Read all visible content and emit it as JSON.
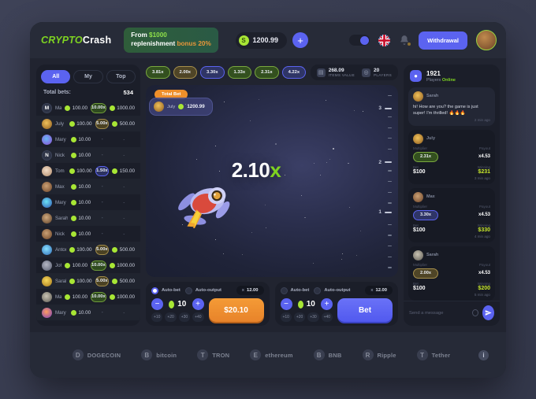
{
  "header": {
    "logo_part1": "CRYPTO",
    "logo_part2": "Crash",
    "promo_line1_pre": "From ",
    "promo_amount": "$1000",
    "promo_line2_pre": "replenishment ",
    "promo_bonus": "bonus 20%",
    "balance": "1200.99",
    "coin_symbol": "S",
    "add_funds_label": "+",
    "withdraw_label": "Withdrawal",
    "icons": {
      "theme": "moon-icon",
      "language": "uk-flag-icon",
      "notifications": "bell-icon",
      "profile": "avatar"
    }
  },
  "bets_panel": {
    "tabs": [
      {
        "label": "All",
        "active": true
      },
      {
        "label": "My",
        "active": false
      },
      {
        "label": "Top",
        "active": false
      }
    ],
    "total_label": "Total bets:",
    "total_value": "534",
    "rows": [
      {
        "name": "Mark",
        "avatar": "letter",
        "initial": "M",
        "bet": "100.00",
        "mult": "10.00x",
        "mult_style": "m-green",
        "win": "1000.00"
      },
      {
        "name": "July",
        "avatar": "p1",
        "initial": "",
        "bet": "100.00",
        "mult": "5.00x",
        "mult_style": "m-gold",
        "win": "500.00"
      },
      {
        "name": "Mary",
        "avatar": "p2",
        "initial": "",
        "bet": "10.00",
        "mult": "-",
        "mult_style": "m-none",
        "win": "-"
      },
      {
        "name": "Nick",
        "avatar": "letter",
        "initial": "N",
        "bet": "10.00",
        "mult": "-",
        "mult_style": "m-none",
        "win": "-"
      },
      {
        "name": "Tom",
        "avatar": "p3",
        "initial": "",
        "bet": "100.00",
        "mult": "1.50x",
        "mult_style": "m-blue",
        "win": "150.00"
      },
      {
        "name": "Max",
        "avatar": "p4",
        "initial": "",
        "bet": "10.00",
        "mult": "-",
        "mult_style": "m-none",
        "win": "-"
      },
      {
        "name": "Mary",
        "avatar": "p5",
        "initial": "",
        "bet": "10.00",
        "mult": "-",
        "mult_style": "m-none",
        "win": "-"
      },
      {
        "name": "Sarah",
        "avatar": "p6",
        "initial": "",
        "bet": "10.00",
        "mult": "-",
        "mult_style": "m-none",
        "win": "-"
      },
      {
        "name": "Nick",
        "avatar": "p4",
        "initial": "",
        "bet": "10.00",
        "mult": "-",
        "mult_style": "m-none",
        "win": "-"
      },
      {
        "name": "Antony",
        "avatar": "p7",
        "initial": "",
        "bet": "100.00",
        "mult": "5.00x",
        "mult_style": "m-gold",
        "win": "500.00"
      },
      {
        "name": "John",
        "avatar": "p8",
        "initial": "",
        "bet": "100.00",
        "mult": "10.00x",
        "mult_style": "m-green",
        "win": "1000.00"
      },
      {
        "name": "Sarah",
        "avatar": "p9",
        "initial": "",
        "bet": "100.00",
        "mult": "5.00x",
        "mult_style": "m-gold",
        "win": "500.00"
      },
      {
        "name": "Max",
        "avatar": "p10",
        "initial": "",
        "bet": "100.00",
        "mult": "10.00x",
        "mult_style": "m-green",
        "win": "1000.00"
      },
      {
        "name": "Mary",
        "avatar": "p11",
        "initial": "",
        "bet": "10.00",
        "mult": "-",
        "mult_style": "m-none",
        "win": "-"
      }
    ]
  },
  "game": {
    "history": [
      {
        "value": "3.81x",
        "style": "m-green"
      },
      {
        "value": "2.00x",
        "style": "m-gold"
      },
      {
        "value": "3.30x",
        "style": "m-blue"
      },
      {
        "value": "1.33x",
        "style": "m-green"
      },
      {
        "value": "2.31x",
        "style": "m-green"
      },
      {
        "value": "4.22x",
        "style": "m-blue"
      }
    ],
    "stats": [
      {
        "icon": "items-icon",
        "value": "268.09",
        "label": "ITEMS VALUE"
      },
      {
        "icon": "players-icon",
        "value": "20",
        "label": "PLAYERS"
      }
    ],
    "total_bet_chip": "Total Bet",
    "player_bet": {
      "name": "July",
      "value": "1200.99"
    },
    "multiplier": "2.10",
    "multiplier_suffix": "x",
    "axis_ticks": [
      "3",
      "2",
      "1"
    ],
    "rocket_icon": "rocket-astronaut-icon"
  },
  "controls": {
    "left": {
      "auto_bet_label": "Auto-bet",
      "auto_bet_on": true,
      "auto_output_label": "Auto-output",
      "auto_output_on": false,
      "auto_output_value": "12.00",
      "auto_output_prefix": "x",
      "amount": "10",
      "decrement": "−",
      "increment": "+",
      "quick_adds": [
        "+10",
        "+20",
        "+30",
        "+40"
      ],
      "action_label": "$20.10",
      "action_kind": "cashout"
    },
    "right": {
      "auto_bet_label": "Auto-bet",
      "auto_bet_on": false,
      "auto_output_label": "Auto-output",
      "auto_output_on": false,
      "auto_output_value": "12.00",
      "auto_output_prefix": "x",
      "amount": "10",
      "decrement": "−",
      "increment": "+",
      "quick_adds": [
        "+10",
        "+20",
        "+30",
        "+40"
      ],
      "action_label": "Bet",
      "action_kind": "bet"
    }
  },
  "chat": {
    "online_count": "1921",
    "online_label_pre": "Players ",
    "online_label_status": "Online",
    "message": {
      "author": "Sarah",
      "text": "hi! How are you? the game is just super! I'm thrilled! 🔥🔥🔥",
      "time": "2 min ago"
    },
    "labels": {
      "multiplier": "Multiplier",
      "payout": "Payout",
      "bet": "Bet",
      "winning": "Winning"
    },
    "cards": [
      {
        "author": "July",
        "mult": "2.31x",
        "mult_style": "m-green",
        "payout": "x4.53",
        "bet": "$100",
        "win": "$231",
        "time": "3 min ago",
        "avatar": "p1"
      },
      {
        "author": "Max",
        "mult": "3.30x",
        "mult_style": "m-blue",
        "payout": "x4.53",
        "bet": "$100",
        "win": "$330",
        "time": "4 min ago",
        "avatar": "p4"
      },
      {
        "author": "Sarah",
        "mult": "2.00x",
        "mult_style": "m-gold",
        "payout": "x4.53",
        "bet": "$100",
        "win": "$200",
        "time": "5 min ago",
        "avatar": "p10"
      }
    ],
    "input_placeholder": "Send a message",
    "send_icon": "send-icon",
    "emoji_icon": "emoji-icon"
  },
  "footer": {
    "coins": [
      {
        "symbol": "D",
        "name": "DOGECOIN"
      },
      {
        "symbol": "B",
        "name": "bitcoin"
      },
      {
        "symbol": "T",
        "name": "TRON"
      },
      {
        "symbol": "E",
        "name": "ethereum"
      },
      {
        "symbol": "B",
        "name": "BNB"
      },
      {
        "symbol": "R",
        "name": "Ripple"
      },
      {
        "symbol": "T",
        "name": "Tether"
      }
    ],
    "info_label": "i"
  },
  "colors": {
    "accent": "#5b63f0",
    "green": "#7ed321",
    "orange": "#ef8f2a",
    "win": "#c8e82b"
  }
}
